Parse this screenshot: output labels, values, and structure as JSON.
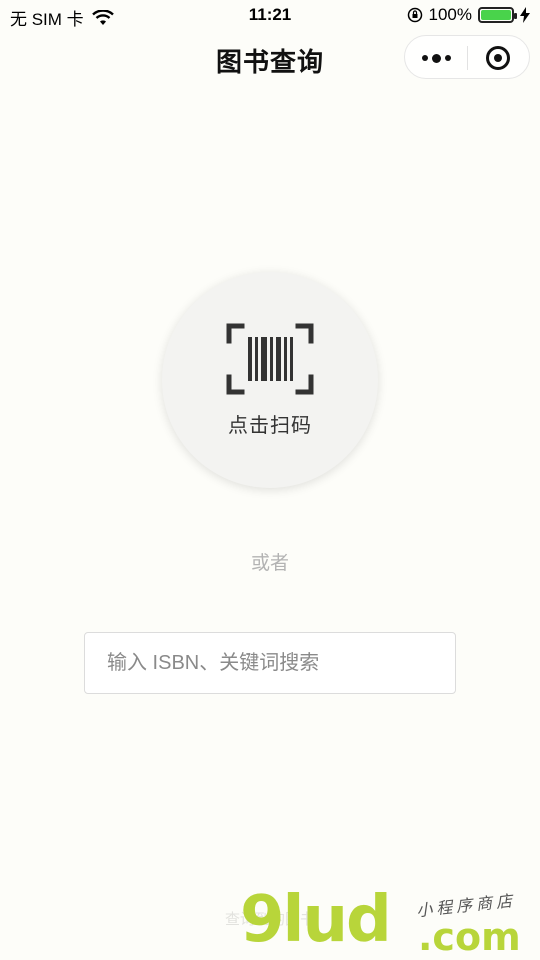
{
  "status_bar": {
    "carrier": "无 SIM 卡",
    "time": "11:21",
    "battery_percent": "100%"
  },
  "nav": {
    "title": "图书查询"
  },
  "scan": {
    "label": "点击扫码",
    "icon": "barcode-scan-icon"
  },
  "divider_text": "或者",
  "search": {
    "placeholder": "输入 ISBN、关键词搜索",
    "value": ""
  },
  "footer": {
    "note": "查询到的图书"
  },
  "watermark": {
    "logo": "9lud",
    "domain": ".com",
    "tagline": "小程序商店"
  },
  "colors": {
    "background": "#fdfdf9",
    "watermark_green": "#b8d53a",
    "battery_green": "#49d34b"
  }
}
